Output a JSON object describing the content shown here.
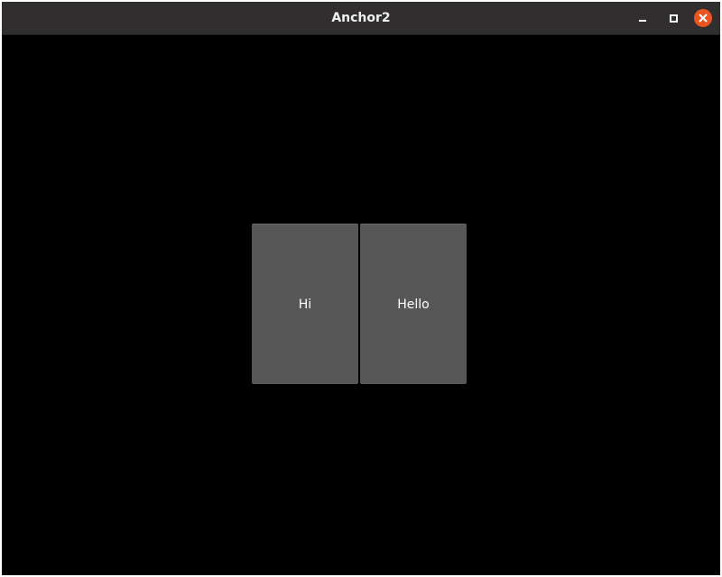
{
  "window": {
    "title": "Anchor2",
    "controls": {
      "minimize_icon": "minimize-icon",
      "maximize_icon": "maximize-icon",
      "close_icon": "close-icon",
      "close_color": "#e95420"
    }
  },
  "content": {
    "background": "#000000",
    "buttons": [
      {
        "label": "Hi"
      },
      {
        "label": "Hello"
      }
    ]
  }
}
